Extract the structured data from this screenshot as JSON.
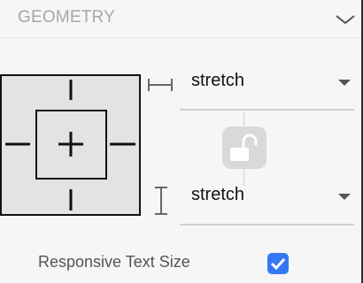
{
  "section": {
    "title": "GEOMETRY",
    "collapse_icon": "chevron-down-icon"
  },
  "anchor": {
    "icon": "anchor-center-icon"
  },
  "width_sizing": {
    "icon": "horizontal-size-icon",
    "value": "stretch"
  },
  "height_sizing": {
    "icon": "vertical-size-icon",
    "value": "stretch"
  },
  "aspect_lock": {
    "icon": "unlocked-padlock-icon",
    "locked": false
  },
  "responsive_text": {
    "label": "Responsive Text Size",
    "checked": true
  },
  "colors": {
    "accent": "#3478f6",
    "title": "#a7a7a7",
    "anchor_bg": "#e3e3e3"
  }
}
